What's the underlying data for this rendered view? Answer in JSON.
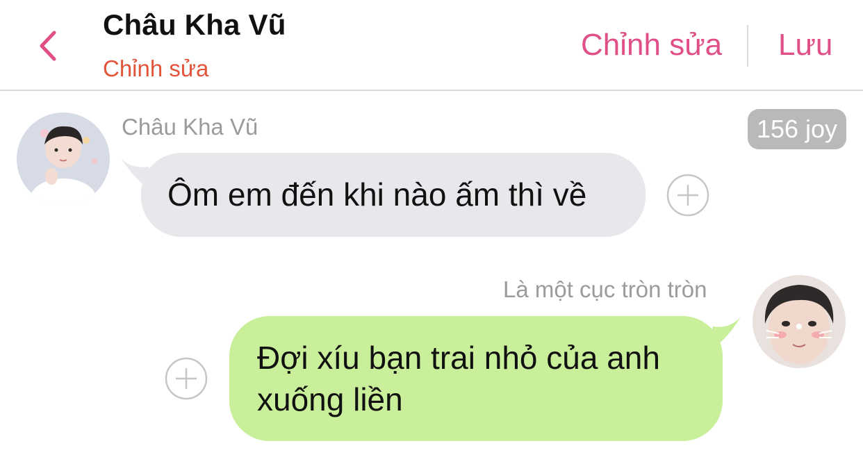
{
  "header": {
    "title": "Châu Kha Vũ",
    "subtitle": "Chỉnh sửa",
    "edit_label": "Chỉnh sửa",
    "save_label": "Lưu"
  },
  "messages": [
    {
      "sender": "Châu Kha Vũ",
      "text": "Ôm em đến khi nào ấm thì về",
      "side": "left",
      "badge": "156 joy"
    },
    {
      "sender": "Là một cục tròn tròn",
      "text": "Đợi xíu bạn trai nhỏ của anh xuống liền",
      "side": "right"
    }
  ],
  "icons": {
    "back": "chevron-left-icon",
    "add": "plus-circle-icon"
  },
  "colors": {
    "accent_pink": "#e04f86",
    "subtitle_red": "#e2553b",
    "bubble_left": "#e6e8eb",
    "bubble_right": "#c9ef9a",
    "badge_bg": "#b9b9bc"
  }
}
